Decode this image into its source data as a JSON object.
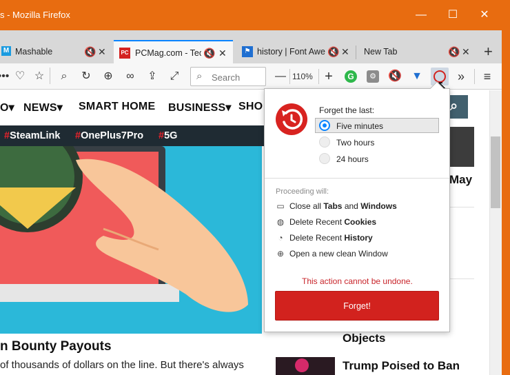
{
  "window": {
    "title": "s - Mozilla Firefox",
    "controls": {
      "minimize": "—",
      "maximize": "☐",
      "close": "✕"
    }
  },
  "tabs": [
    {
      "label": "Mashable",
      "favicon": "M",
      "favicon_color": "#1a9be0",
      "active": false
    },
    {
      "label": "PCMag.com - Tech",
      "favicon": "PC",
      "favicon_color": "#d42221",
      "active": true
    },
    {
      "label": "history | Font Awe",
      "favicon": "flag-icon",
      "favicon_color": "#1f6fd1",
      "active": false
    },
    {
      "label": "New Tab",
      "favicon": "",
      "active": false
    }
  ],
  "toolbar": {
    "search_placeholder": "Search",
    "zoom_level": "110%",
    "zoom_out": "—",
    "zoom_in": "+"
  },
  "page": {
    "nav": [
      "O▾",
      "NEWS▾",
      "SMART HOME",
      "BUSINESS▾",
      "SHO"
    ],
    "hashtags": [
      {
        "hash": "#",
        "text": "SteamLink"
      },
      {
        "hash": "#",
        "text": "OnePlus7Pro"
      },
      {
        "hash": "#",
        "text": "5G"
      }
    ],
    "headline": "n Bounty Payouts",
    "subline": "of thousands of dollars on the line. But there's always",
    "right_titles": [
      "May",
      "Objects",
      "Trump Poised to Ban"
    ],
    "accent_color": "#e8232c"
  },
  "popup": {
    "forget_label": "Forget the last:",
    "options": [
      {
        "label": "Five minutes",
        "selected": true
      },
      {
        "label": "Two hours",
        "selected": false
      },
      {
        "label": "24 hours",
        "selected": false
      }
    ],
    "proceeding_label": "Proceeding will:",
    "actions": {
      "a1": {
        "pre": "Close all ",
        "b1": "Tabs",
        "mid": " and ",
        "b2": "Windows"
      },
      "a2": {
        "pre": "Delete Recent ",
        "b1": "Cookies"
      },
      "a3": {
        "pre": "Delete Recent ",
        "b1": "History"
      },
      "a4": {
        "pre": "Open a new clean Window"
      }
    },
    "warning": "This action cannot be undone.",
    "button": "Forget!",
    "brand_color": "#d2221e"
  }
}
